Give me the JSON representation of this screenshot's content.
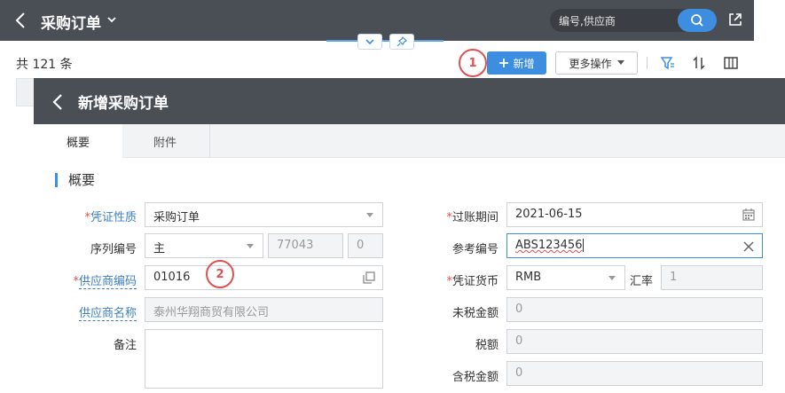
{
  "top_header": {
    "title": "采购订单",
    "search_placeholder": "编号,供应商"
  },
  "toolbar": {
    "count_text": "共 121 条",
    "new_label": "新增",
    "more_label": "更多操作",
    "marker_1": "1"
  },
  "modal": {
    "title": "新增采购订单",
    "tabs": [
      {
        "label": "概要",
        "active": true
      },
      {
        "label": "附件",
        "active": false
      }
    ],
    "section_title": "概要",
    "marker_2": "2",
    "left_fields": {
      "voucher_type": {
        "label": "凭证性质",
        "required": "*",
        "value": "采购订单"
      },
      "serial_no": {
        "label": "序列编号",
        "value": "主",
        "number": "77043",
        "suffix": "0"
      },
      "supplier_code": {
        "label": "供应商编码",
        "required": "*",
        "value": "01016"
      },
      "supplier_name": {
        "label": "供应商名称",
        "value": "泰州华翔商贸有限公司"
      },
      "remark": {
        "label": "备注",
        "value": ""
      }
    },
    "right_fields": {
      "posting_period": {
        "label": "过账期间",
        "required": "*",
        "value": "2021-06-15"
      },
      "reference_no": {
        "label": "参考编号",
        "value": "ABS123456"
      },
      "currency": {
        "label": "凭证货币",
        "required": "*",
        "value": "RMB",
        "rate_label": "汇率",
        "rate_value": "1"
      },
      "amount_excl_tax": {
        "label": "未税金额",
        "value": "0"
      },
      "tax": {
        "label": "税额",
        "value": "0"
      },
      "amount_incl_tax": {
        "label": "含税金额",
        "value": "0"
      }
    }
  },
  "colors": {
    "header_bg": "#4a4f56",
    "accent": "#3d8ee0",
    "marker": "#e05050",
    "link": "#3d7fc4"
  }
}
